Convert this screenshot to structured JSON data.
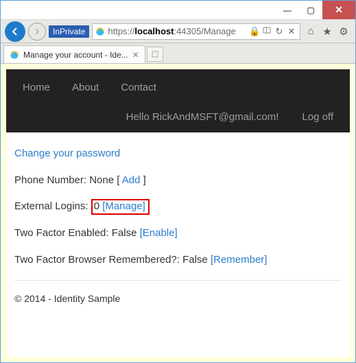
{
  "window": {
    "min": "—",
    "max": "▢",
    "close": "✕"
  },
  "urlbar": {
    "inprivate": "InPrivate",
    "scheme": "https://",
    "host": "localhost",
    "rest": ":44305/Manage",
    "refresh": "↻",
    "stop": "✕"
  },
  "tab": {
    "title": "Manage your account - Ide...",
    "close": "✕"
  },
  "nav": {
    "home": "Home",
    "about": "About",
    "contact": "Contact",
    "hello": "Hello RickAndMSFT@gmail.com!",
    "logoff": "Log off"
  },
  "page": {
    "change_pw": "Change your password",
    "phone_label": "Phone Number: None [ ",
    "phone_add": "Add",
    "phone_close": " ]",
    "ext_label": "External Logins:",
    "ext_count": "0",
    "ext_manage": "[Manage]",
    "tfe_label": "Two Factor Enabled: False ",
    "tfe_link": "[Enable]",
    "tfbr_label": "Two Factor Browser Remembered?: False ",
    "tfbr_link": "[Remember]",
    "footer": "© 2014 - Identity Sample"
  }
}
